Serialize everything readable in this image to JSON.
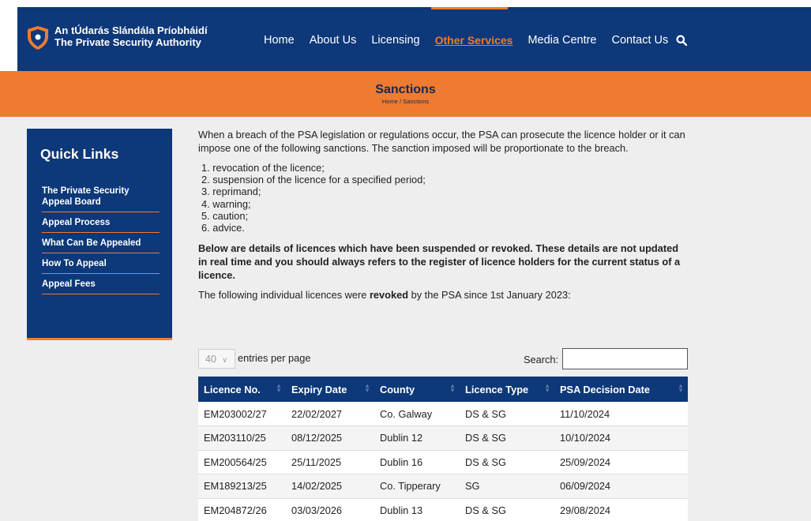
{
  "header": {
    "logo_line1": "An tÚdarás Slándála Príobháidí",
    "logo_line2": "The Private Security Authority",
    "nav": [
      "Home",
      "About Us",
      "Licensing",
      "Other Services",
      "Media Centre",
      "Contact Us"
    ],
    "active_nav": "Other Services",
    "search_icon": "search-icon",
    "colors": {
      "navy": "#0d3879",
      "orange": "#ef7b30"
    }
  },
  "banner": {
    "title": "Sanctions",
    "breadcrumb_home": "Home",
    "breadcrumb_sep": "/",
    "breadcrumb_current": "Sanctions"
  },
  "sidebar": {
    "title": "Quick Links",
    "items": [
      "The Private Security Appeal Board",
      "Appeal Process",
      "What Can Be Appealed",
      "How To Appeal",
      "Appeal Fees"
    ]
  },
  "content": {
    "intro": "When a breach of the PSA legislation or regulations occur, the PSA can prosecute the licence holder or it can impose one of the following sanctions. The sanction imposed will be proportionate to the breach.",
    "sanctions": [
      "1. revocation of the licence;",
      "2. suspension of the licence for a specified period;",
      "3. reprimand;",
      "4.  warning;",
      "5. caution;",
      "6. advice."
    ],
    "note": "Below are details of licences which have been suspended or revoked. These details are not updated in real time and you should always refers to the register of licence holders for the current status of a licence.",
    "revoked_prefix": "The following individual licences were ",
    "revoked_word": "revoked",
    "revoked_suffix": " by the PSA since 1st January 2023:"
  },
  "table_controls": {
    "entries_value": "40",
    "entries_label": "entries per page",
    "search_label": "Search:",
    "search_value": ""
  },
  "table": {
    "headers": [
      "Licence No.",
      "Expiry Date",
      "County",
      "Licence Type",
      "PSA Decision Date"
    ],
    "rows": [
      [
        "EM203002/27",
        "22/02/2027",
        "Co. Galway",
        "DS & SG",
        "11/10/2024"
      ],
      [
        "EM203110/25",
        "08/12/2025",
        "Dublin 12",
        "DS & SG",
        "10/10/2024"
      ],
      [
        "EM200564/25",
        "25/11/2025",
        "Dublin 16",
        "DS & SG",
        "25/09/2024"
      ],
      [
        "EM189213/25",
        "14/02/2025",
        "Co. Tipperary",
        "SG",
        "06/09/2024"
      ],
      [
        "EM204872/26",
        "03/03/2026",
        "Dublin 13",
        "DS & SG",
        "29/08/2024"
      ]
    ]
  }
}
